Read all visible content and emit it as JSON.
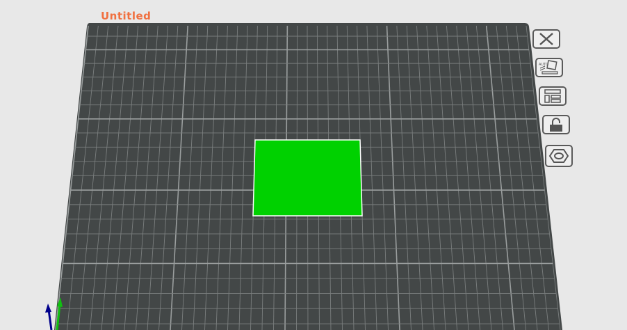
{
  "project": {
    "title": "Untitled"
  },
  "toolbar": {
    "items": [
      {
        "name": "delete",
        "icon": "close-icon"
      },
      {
        "name": "auto-arrange",
        "icon": "auto-arrange-icon",
        "label": "AUTO"
      },
      {
        "name": "layout",
        "icon": "layout-icon"
      },
      {
        "name": "lock",
        "icon": "unlock-icon"
      },
      {
        "name": "settings",
        "icon": "hex-nut-icon"
      }
    ]
  },
  "colors": {
    "plate": "#434747",
    "grid": "#8a8e8e",
    "object": "#00d100",
    "title": "#f07040"
  }
}
